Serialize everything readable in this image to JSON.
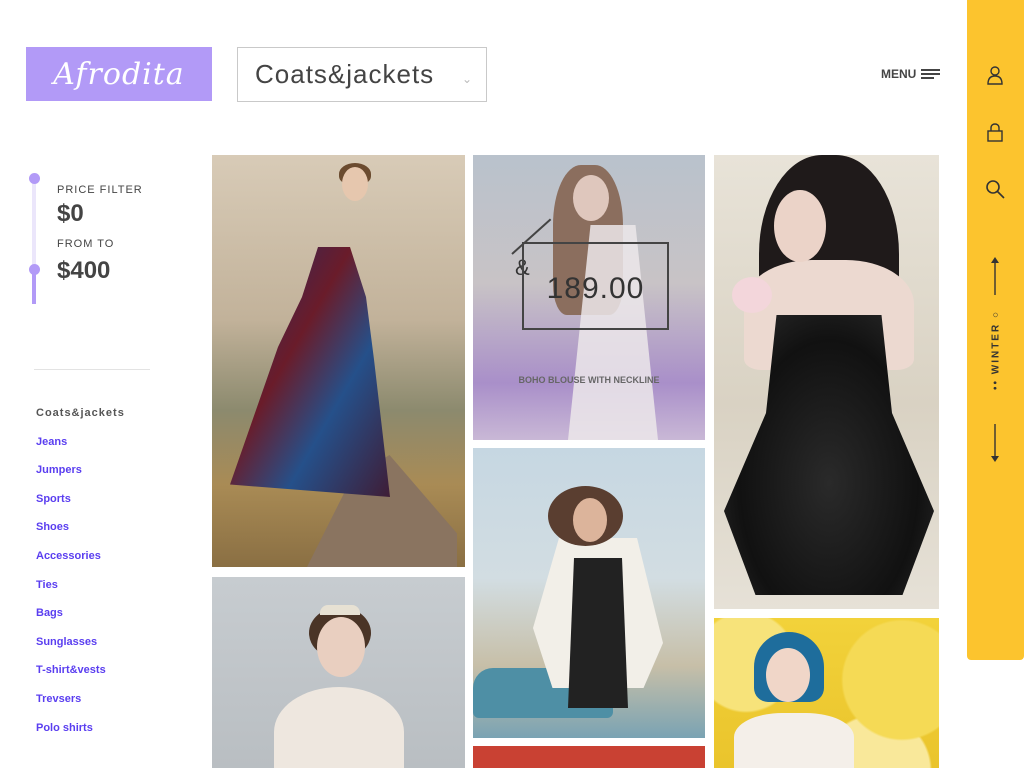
{
  "header": {
    "logo_text": "Afrodita",
    "category_value": "Coats&jackets",
    "menu_label": "MENU"
  },
  "filter": {
    "price_filter_label": "PRICE FILTER",
    "min_price": "$0",
    "from_to_label": "FROM TO",
    "max_price": "$400"
  },
  "categories": {
    "items": [
      "Coats&jackets",
      "Jeans",
      "Jumpers",
      "Sports",
      "Shoes",
      "Accessories",
      "Ties",
      "Bags",
      "Sunglasses",
      "T-shirt&vests",
      "Trevsers",
      "Polo shirts"
    ],
    "active_index": 0
  },
  "product": {
    "currency_symbol": "&",
    "price": "189.00",
    "name": "BOHO BLOUSE WITH NECKLINE"
  },
  "rail": {
    "season_label": "•• WINTER ○",
    "icons": [
      "user-icon",
      "lock-icon",
      "search-icon"
    ]
  },
  "colors": {
    "accent_purple": "#b29af7",
    "link_blue": "#5a3ef0",
    "rail_yellow": "#fcc42e"
  }
}
